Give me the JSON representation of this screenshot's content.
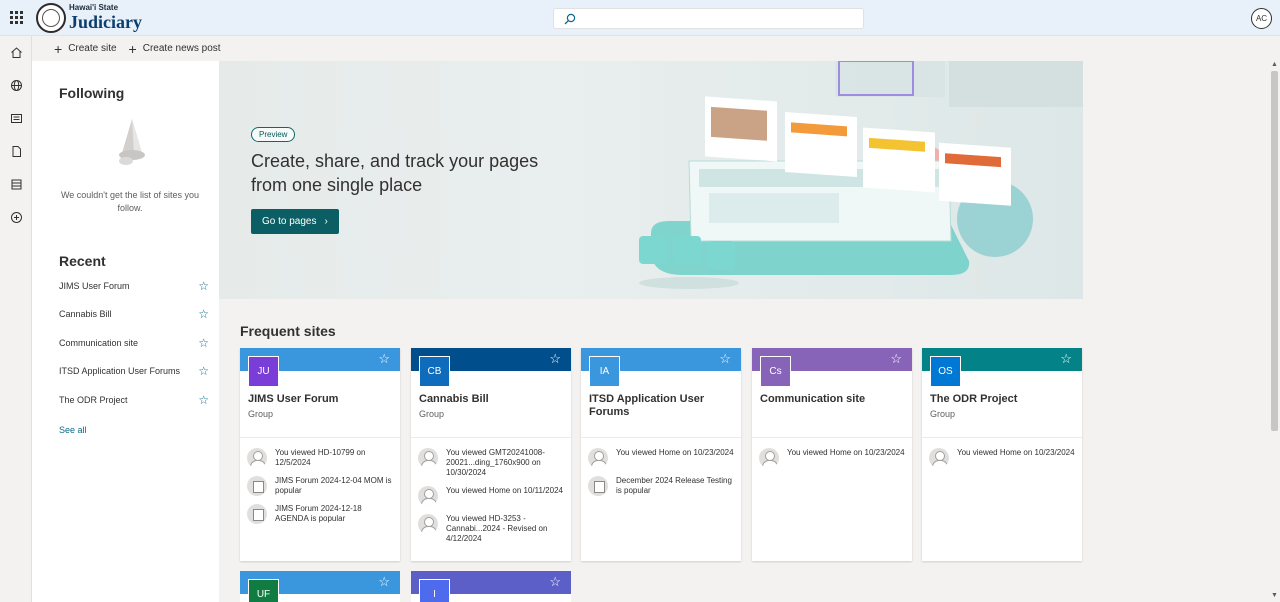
{
  "suitebar": {
    "logo_small": "Hawai'i State",
    "logo_big": "Judiciary",
    "search_placeholder": "",
    "avatar_initials": "AC"
  },
  "commandbar": {
    "create_site": "Create site",
    "create_news": "Create news post"
  },
  "leftpanel": {
    "following_title": "Following",
    "following_empty": "We couldn't get the list of sites you follow.",
    "recent_title": "Recent",
    "recent": [
      {
        "label": "JIMS User Forum"
      },
      {
        "label": "Cannabis Bill"
      },
      {
        "label": "Communication site"
      },
      {
        "label": "ITSD Application User Forums"
      },
      {
        "label": "The ODR Project"
      }
    ],
    "see_all": "See all"
  },
  "hero": {
    "badge": "Preview",
    "title": "Create, share, and track your pages from one single place",
    "button": "Go to pages"
  },
  "frequent": {
    "title": "Frequent sites",
    "cards": [
      {
        "initials": "JU",
        "name": "JIMS User Forum",
        "type": "Group",
        "band_color": "#3a96dd",
        "tile_color": "#7a3dd8",
        "activity": [
          {
            "icon": "person",
            "text": "You viewed HD-10799 on 12/5/2024"
          },
          {
            "icon": "doc",
            "text": "JIMS Forum 2024-12-04 MOM is popular"
          },
          {
            "icon": "doc",
            "text": "JIMS Forum 2024-12-18 AGENDA is popular"
          }
        ]
      },
      {
        "initials": "CB",
        "name": "Cannabis Bill",
        "type": "Group",
        "band_color": "#004e8c",
        "tile_color": "#0f6cbd",
        "activity": [
          {
            "icon": "person",
            "text": "You viewed GMT20241008-20021...ding_1760x900 on 10/30/2024"
          },
          {
            "icon": "person",
            "text": "You viewed Home on 10/11/2024"
          },
          {
            "icon": "person",
            "text": "You viewed HD-3253 - Cannabi...2024 - Revised on 4/12/2024"
          }
        ]
      },
      {
        "initials": "IA",
        "name": "ITSD Application User Forums",
        "type": "",
        "band_color": "#3a96dd",
        "tile_color": "#3a96dd",
        "activity": [
          {
            "icon": "person",
            "text": "You viewed Home on 10/23/2024"
          },
          {
            "icon": "doc",
            "text": "December 2024 Release Testing is popular"
          }
        ]
      },
      {
        "initials": "Cs",
        "name": "Communication site",
        "type": "",
        "band_color": "#8764b8",
        "tile_color": "#8764b8",
        "activity": [
          {
            "icon": "person",
            "text": "You viewed Home on 10/23/2024"
          }
        ]
      },
      {
        "initials": "OS",
        "name": "The ODR Project",
        "type": "Group",
        "band_color": "#038387",
        "tile_color": "#0078d4",
        "activity": [
          {
            "icon": "person",
            "text": "You viewed Home on 10/23/2024"
          }
        ]
      }
    ],
    "peek_cards": [
      {
        "initials": "UF",
        "band_color": "#3a96dd",
        "tile_color": "#107c41"
      },
      {
        "initials": "I",
        "band_color": "#5b5fc7",
        "tile_color": "#4f6bed"
      }
    ]
  }
}
